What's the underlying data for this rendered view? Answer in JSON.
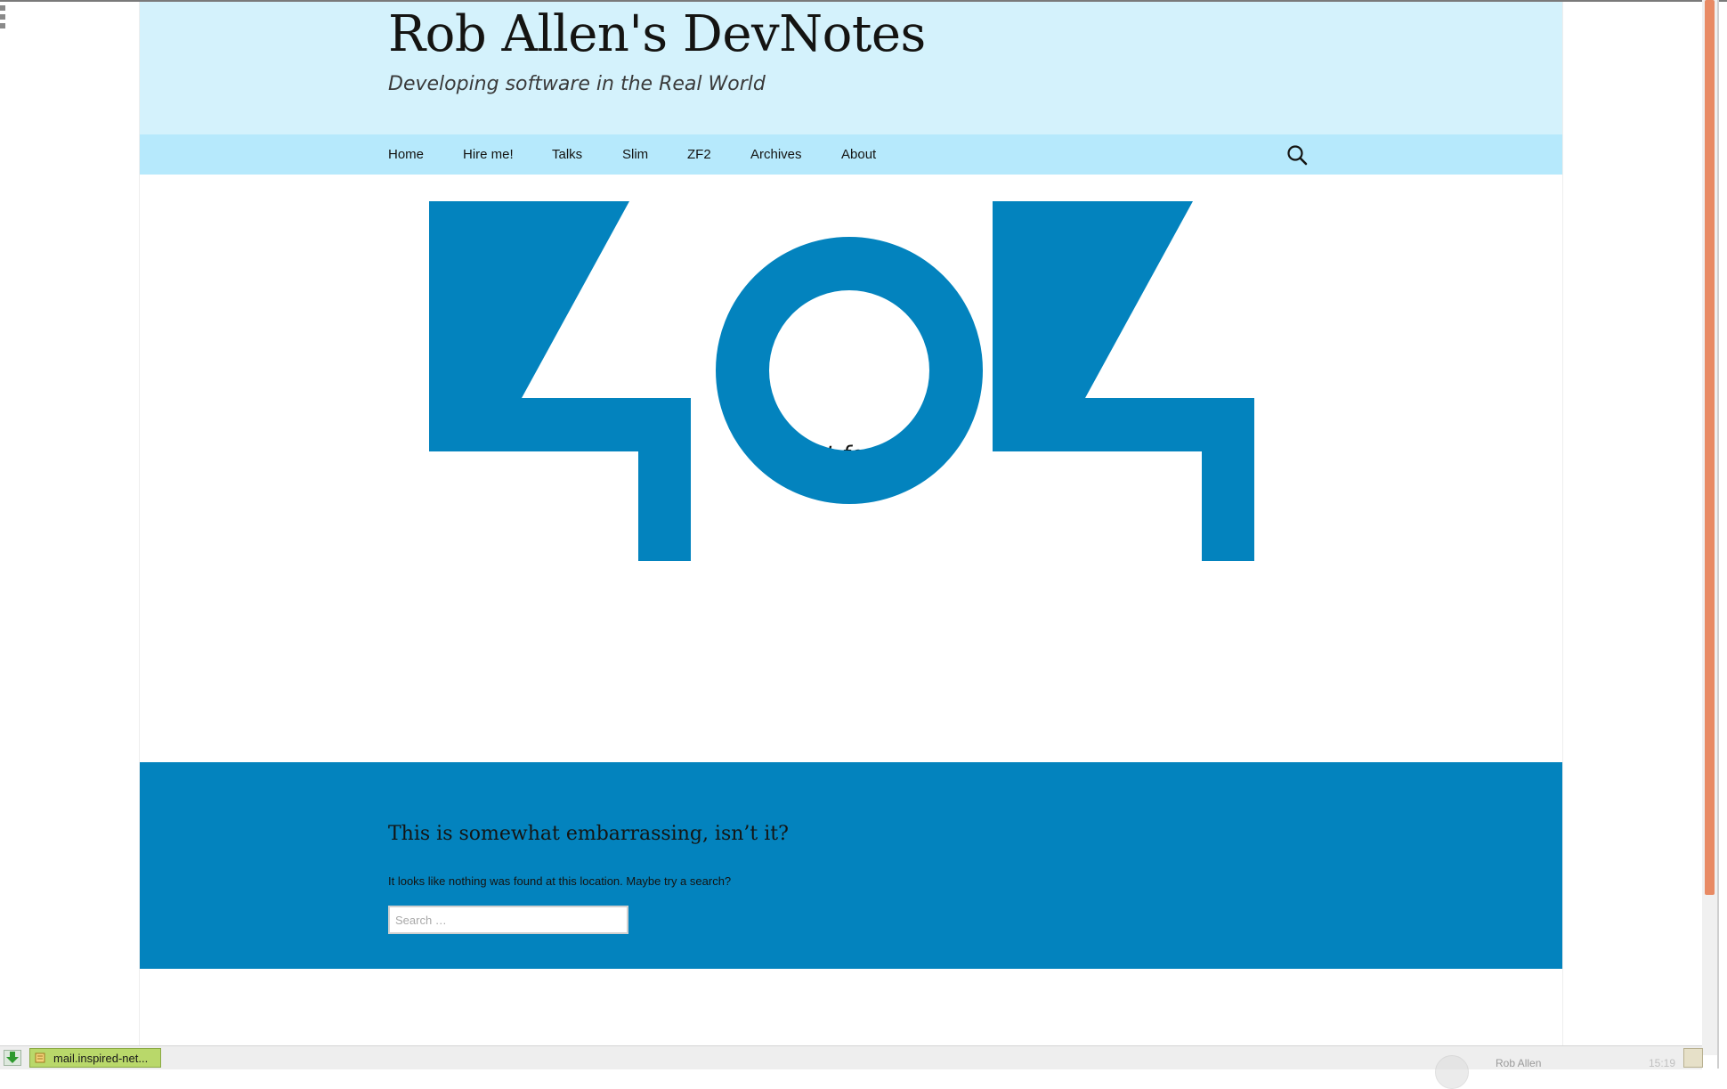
{
  "site": {
    "title": "Rob Allen's DevNotes",
    "tagline": "Developing software in the Real World"
  },
  "nav": {
    "items": [
      {
        "label": "Home"
      },
      {
        "label": "Hire me!"
      },
      {
        "label": "Talks"
      },
      {
        "label": "Slim"
      },
      {
        "label": "ZF2"
      },
      {
        "label": "Archives"
      },
      {
        "label": "About"
      }
    ],
    "search_icon": "search-icon"
  },
  "main": {
    "big_number": "404",
    "heading": "Not found"
  },
  "error_panel": {
    "title": "This is somewhat embarrassing, isn’t it?",
    "text": "It looks like nothing was found at this location. Maybe try a search?",
    "search_placeholder": "Search …"
  },
  "taskbar": {
    "task_label": "mail.inspired-net...",
    "notification_name": "Rob Allen",
    "notification_time": "15:19"
  },
  "colors": {
    "header_bg": "#d4f2fc",
    "nav_bg": "#b6e9fc",
    "accent_blue": "#0383be",
    "scrollbar_thumb": "#e88a64"
  }
}
